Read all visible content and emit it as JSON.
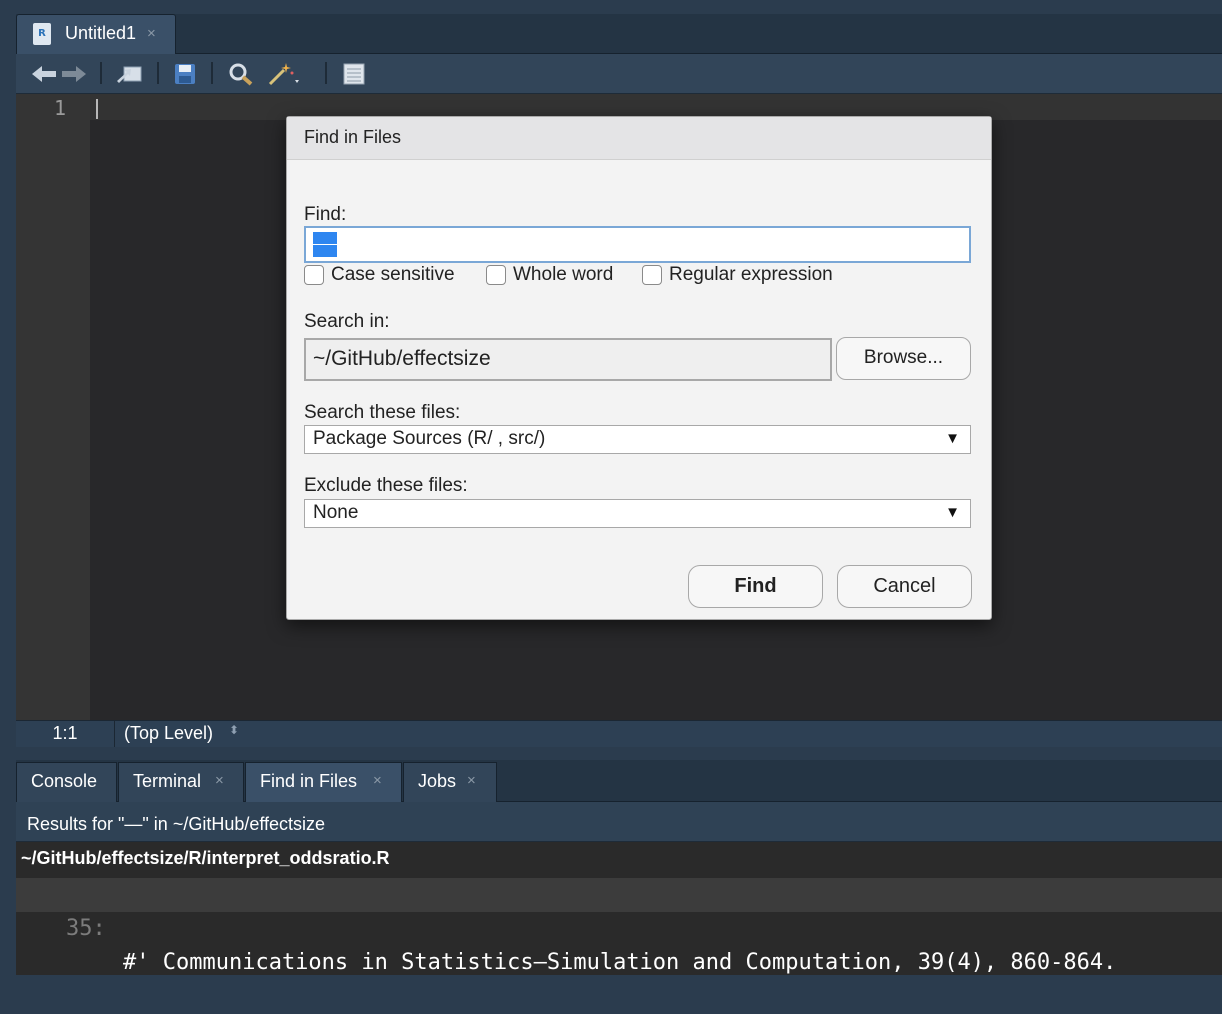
{
  "editor": {
    "tab_title": "Untitled1",
    "tab_close": "×",
    "file_icon_letter": "R",
    "line_number": "1",
    "status": {
      "cursor_position": "1:1",
      "scope": "(Top Level)",
      "scope_arrow": "⬍"
    }
  },
  "toolbar": {
    "back_icon": "arrow-left-icon",
    "forward_icon": "arrow-right-icon",
    "show_in_window_icon": "show-in-new-window-icon",
    "save_icon": "save-icon",
    "find_icon": "find-replace-icon",
    "code_tools_icon": "magic-wand-icon",
    "compile_report_icon": "notebook-icon"
  },
  "dialog": {
    "title": "Find in Files",
    "find_label": "Find:",
    "find_value": "",
    "case_sensitive_label": "Case sensitive",
    "whole_word_label": "Whole word",
    "regex_label": "Regular expression",
    "search_in_label": "Search in:",
    "search_in_value": "~/GitHub/effectsize",
    "browse_label": "Browse...",
    "search_files_label": "Search these files:",
    "search_files_value": "Package Sources (R/ , src/)",
    "exclude_files_label": "Exclude these files:",
    "exclude_files_value": "None",
    "dropdown_arrow": "▼",
    "find_button": "Find",
    "cancel_button": "Cancel"
  },
  "bottom_pane": {
    "tabs": [
      {
        "label": "Console"
      },
      {
        "label": "Terminal",
        "close": "×"
      },
      {
        "label": "Find in Files",
        "close": "×"
      },
      {
        "label": "Jobs",
        "close": "×"
      }
    ],
    "results_header": "Results for \"—\" in ~/GitHub/effectsize",
    "result_file": "~/GitHub/effectsize/R/interpret_oddsratio.R",
    "result_line_number": "35:",
    "result_line_text": "#' Communications in Statistics—Simulation and Computation, 39(4), 860-864."
  },
  "colors": {
    "pane_background": "#2b3c4e",
    "editor_background": "#28282a",
    "dialog_background": "#f3f3f3",
    "selection_blue": "#2e86f0",
    "focus_border": "#7aa7d6"
  }
}
